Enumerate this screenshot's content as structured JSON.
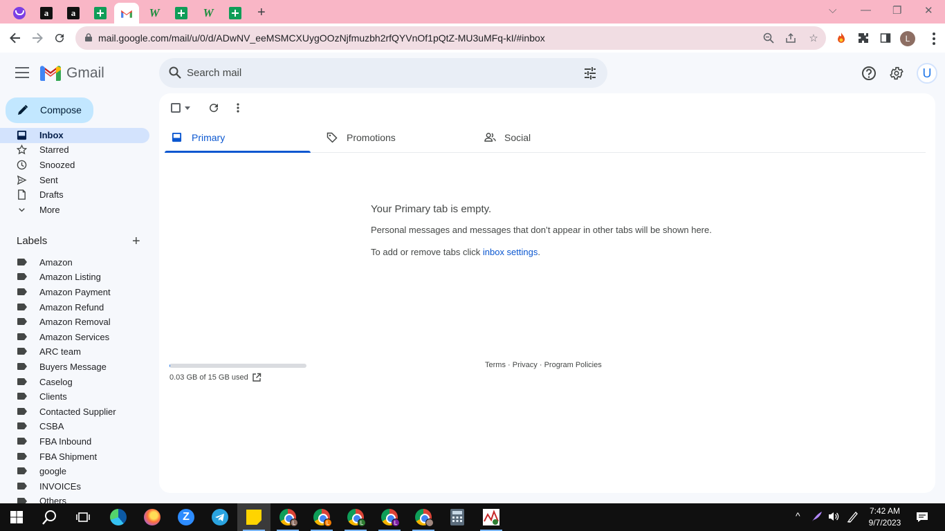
{
  "browser": {
    "tabs": [
      {
        "icon": "purple-circle-icon"
      },
      {
        "icon": "amazon-icon",
        "letter": "a"
      },
      {
        "icon": "amazon-icon",
        "letter": "a"
      },
      {
        "icon": "google-sheets-icon"
      },
      {
        "icon": "gmail-icon",
        "active": true
      },
      {
        "icon": "w-logo-icon",
        "letter": "W"
      },
      {
        "icon": "google-sheets-icon"
      },
      {
        "icon": "w-logo-icon",
        "letter": "W"
      },
      {
        "icon": "google-sheets-icon"
      }
    ],
    "url": "mail.google.com/mail/u/0/d/ADwNV_eeMSMCXUygOOzNjfmuzbh2rfQYVnOf1pQtZ-MU3uMFq-kI/#inbox",
    "profile_letter": "L"
  },
  "gmail": {
    "brand": "Gmail",
    "search_placeholder": "Search mail",
    "avatar_letter": "U",
    "compose_label": "Compose",
    "nav": [
      {
        "label": "Inbox",
        "icon": "inbox-icon",
        "active": true
      },
      {
        "label": "Starred",
        "icon": "star-icon"
      },
      {
        "label": "Snoozed",
        "icon": "clock-icon"
      },
      {
        "label": "Sent",
        "icon": "send-icon"
      },
      {
        "label": "Drafts",
        "icon": "draft-icon"
      },
      {
        "label": "More",
        "icon": "chevron-down-icon"
      }
    ],
    "labels_title": "Labels",
    "labels": [
      "Amazon",
      "Amazon Listing",
      "Amazon Payment",
      "Amazon Refund",
      "Amazon Removal",
      "Amazon Services",
      "ARC team",
      "Buyers Message",
      "Caselog",
      "Clients",
      "Contacted Supplier",
      "CSBA",
      "FBA Inbound",
      "FBA Shipment",
      "google",
      "INVOICEs",
      "Others"
    ],
    "tabs": [
      {
        "label": "Primary",
        "icon": "inbox-icon",
        "selected": true
      },
      {
        "label": "Promotions",
        "icon": "tag-icon"
      },
      {
        "label": "Social",
        "icon": "people-icon"
      }
    ],
    "empty": {
      "title": "Your Primary tab is empty.",
      "subtitle": "Personal messages and messages that don’t appear in other tabs will be shown here.",
      "settings_prefix": "To add or remove tabs click ",
      "settings_link": "inbox settings",
      "settings_suffix": "."
    },
    "storage": {
      "used_text": "0.03 GB of 15 GB used",
      "used_fraction": 0.002
    },
    "footer": {
      "terms": "Terms",
      "privacy": "Privacy",
      "policies": "Program Policies",
      "separator": " · "
    }
  },
  "taskbar": {
    "time": "7:42 AM",
    "date": "9/7/2023",
    "apps": [
      "windows-start-icon",
      "search-icon",
      "task-view-icon",
      "edge-icon",
      "firefox-icon",
      "zoom-icon",
      "telegram-icon",
      "sticky-notes-icon",
      "chrome-icon",
      "chrome-icon",
      "chrome-icon",
      "chrome-icon",
      "chrome-icon",
      "calculator-icon",
      "stock-chart-icon"
    ],
    "chrome_badges": [
      "L",
      "L",
      "L",
      "L",
      ""
    ]
  },
  "colors": {
    "tabstrip": "#f9b6c6",
    "accent": "#0b57d0",
    "compose_bg": "#c2e7ff",
    "nav_active_bg": "#d3e3fd"
  }
}
